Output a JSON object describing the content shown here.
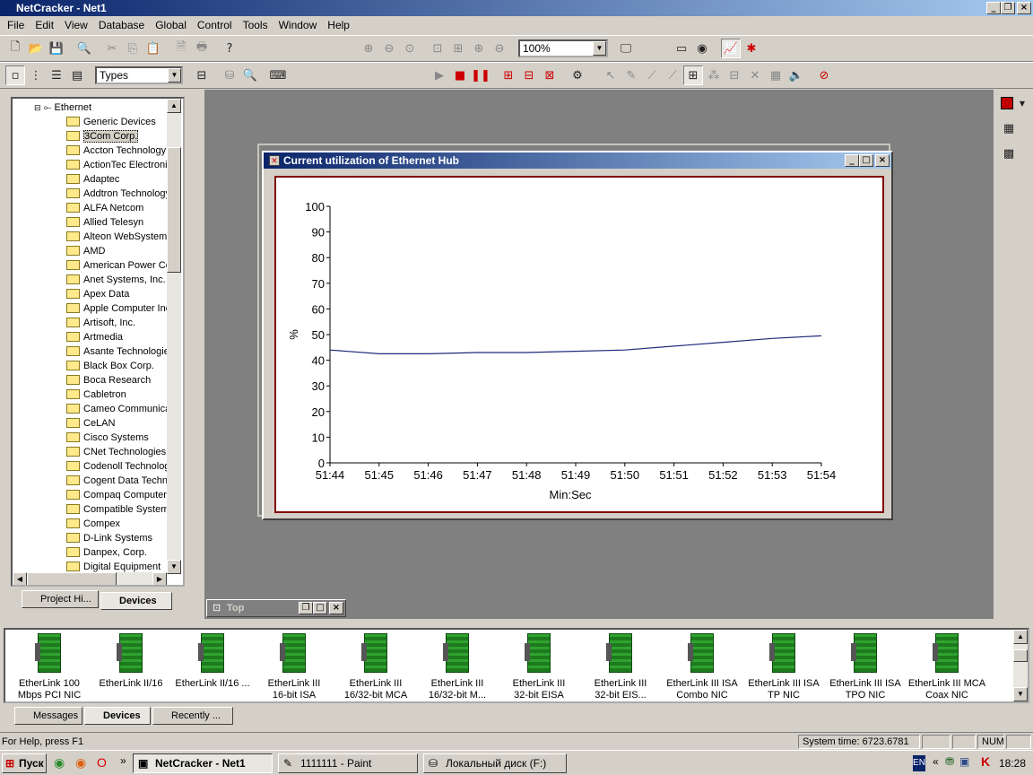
{
  "app": {
    "title": "NetCracker - Net1"
  },
  "menu": [
    "File",
    "Edit",
    "View",
    "Database",
    "Global",
    "Control",
    "Tools",
    "Window",
    "Help"
  ],
  "toolbar": {
    "zoom_value": "100%",
    "types_value": "Types"
  },
  "tree": {
    "root_label": "Ethernet",
    "items": [
      "Generic Devices",
      "3Com Corp.",
      "Accton Technology",
      "ActionTec Electronics",
      "Adaptec",
      "Addtron Technology",
      "ALFA Netcom",
      "Allied Telesyn",
      "Alteon WebSystems",
      "AMD",
      "American Power Co",
      "Anet Systems, Inc.",
      "Apex Data",
      "Apple Computer Inc",
      "Artisoft, Inc.",
      "Artmedia",
      "Asante Technologies",
      "Black Box Corp.",
      "Boca Research",
      "Cabletron",
      "Cameo Communications",
      "CeLAN",
      "Cisco Systems",
      "CNet Technologies",
      "Codenoll Technology",
      "Cogent Data Techn",
      "Compaq Computer",
      "Compatible Systems",
      "Compex",
      "D-Link Systems",
      "Danpex, Corp.",
      "Digital Equipment"
    ],
    "selected_index": 1
  },
  "left_tabs": {
    "project": "Project Hi...",
    "devices": "Devices"
  },
  "chart_window": {
    "title": "Current utilization of Ethernet Hub"
  },
  "chart_data": {
    "type": "line",
    "title": "",
    "xlabel": "Min:Sec",
    "ylabel": "%",
    "ylim": [
      0,
      100
    ],
    "yticks": [
      "0",
      "10",
      "20",
      "30",
      "40",
      "50",
      "60",
      "70",
      "80",
      "90",
      "100"
    ],
    "xticks": [
      "51:44",
      "51:45",
      "51:46",
      "51:47",
      "51:48",
      "51:49",
      "51:50",
      "51:51",
      "51:52",
      "51:53",
      "51:54"
    ],
    "series": [
      {
        "x": [
          "51:44",
          "51:45",
          "51:46",
          "51:47",
          "51:48",
          "51:49",
          "51:50",
          "51:51",
          "51:52",
          "51:53",
          "51:54"
        ],
        "values": [
          44,
          42.5,
          42.5,
          43,
          43,
          43.5,
          44,
          45.5,
          47,
          48.5,
          49.5
        ]
      }
    ],
    "colors": {
      "line": "#1f2a7a"
    },
    "grid": false
  },
  "top_window": {
    "title": "Top"
  },
  "devices": [
    [
      "EtherLink 100",
      "Mbps PCI NIC"
    ],
    [
      "EtherLink II/16",
      ""
    ],
    [
      "EtherLink II/16 ...",
      ""
    ],
    [
      "EtherLink III",
      "16-bit ISA"
    ],
    [
      "EtherLink III",
      "16/32-bit MCA"
    ],
    [
      "EtherLink III",
      "16/32-bit M..."
    ],
    [
      "EtherLink III",
      "32-bit EISA"
    ],
    [
      "EtherLink III",
      "32-bit EIS..."
    ],
    [
      "EtherLink III ISA",
      "Combo NIC"
    ],
    [
      "EtherLink III ISA",
      "TP NIC"
    ],
    [
      "EtherLink III ISA",
      "TPO NIC"
    ],
    [
      "EtherLink III MCA",
      "Coax NIC"
    ]
  ],
  "bottom_tabs": {
    "messages": "Messages",
    "devices": "Devices",
    "recently": "Recently ..."
  },
  "status": {
    "help": "For Help, press F1",
    "system_time": "System time: 6723.6781",
    "num": "NUM"
  },
  "taskbar": {
    "start": "Пуск",
    "task1": "NetCracker - Net1",
    "task2": "1111111 - Paint",
    "task3": "Локальный диск (F:)",
    "lang": "EN",
    "clock": "18:28"
  }
}
